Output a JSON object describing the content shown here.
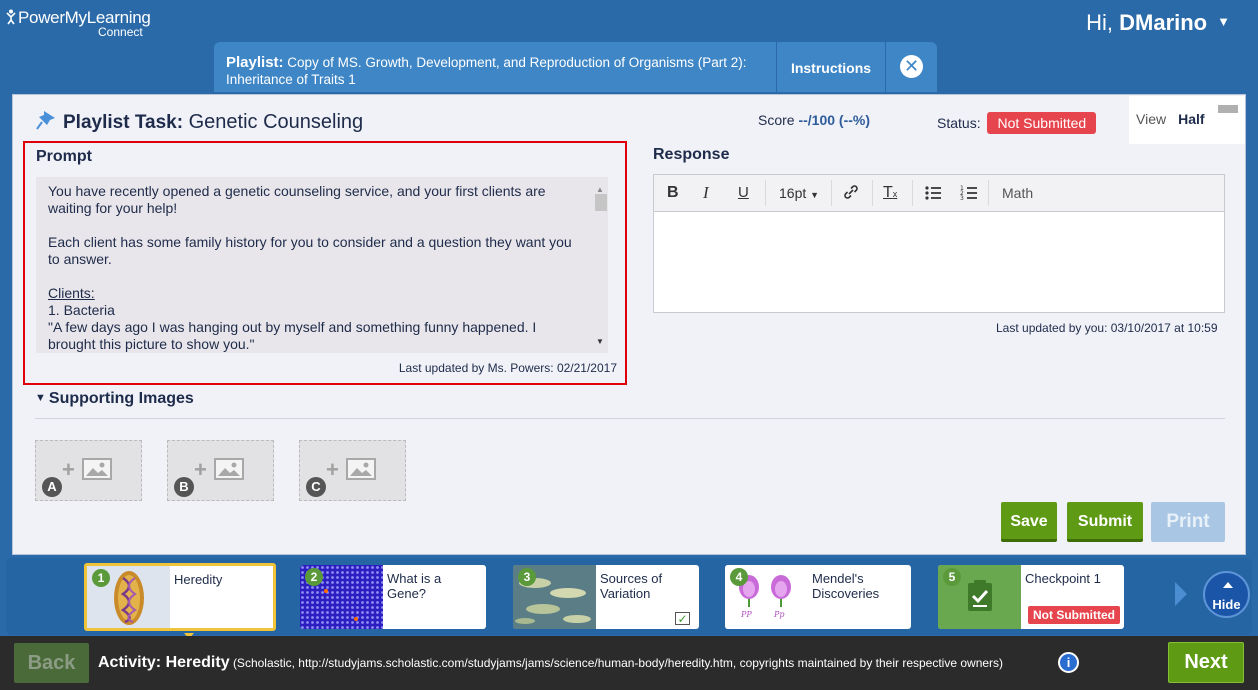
{
  "app": {
    "logo_main": "PowerMyLearning",
    "logo_sub": "Connect",
    "greeting": "Hi,",
    "username": "DMarino"
  },
  "header": {
    "playlist_label": "Playlist:",
    "playlist_title": "Copy of MS. Growth, Development, and Reproduction of Organisms (Part 2): Inheritance of Traits 1",
    "instructions_label": "Instructions"
  },
  "task": {
    "label": "Playlist Task:",
    "name": "Genetic Counseling",
    "score_label": "Score",
    "score_value": "--/100 (--%)",
    "status_label": "Status:",
    "status_value": "Not Submitted",
    "view_label": "View",
    "view_value": "Half"
  },
  "prompt": {
    "label": "Prompt",
    "para1": "You have recently opened a genetic counseling service, and your first clients are waiting for your help!",
    "para2": "Each client has some family history for you to consider and a question they want you to answer.",
    "clients_label": "Clients:",
    "client1": "1. Bacteria",
    "quote": "\"A few days ago I was hanging out by myself and something funny happened.  I brought this picture to show you.\"",
    "updated": "Last updated by Ms. Powers: 02/21/2017"
  },
  "response": {
    "label": "Response",
    "font_size": "16pt",
    "math_label": "Math",
    "updated": "Last updated by you: 03/10/2017 at 10:59"
  },
  "supporting": {
    "label": "Supporting Images",
    "slots": [
      "A",
      "B",
      "C"
    ]
  },
  "actions": {
    "save": "Save",
    "submit": "Submit",
    "print": "Print"
  },
  "activities": [
    {
      "num": "1",
      "title": "Heredity"
    },
    {
      "num": "2",
      "title": "What is a Gene?"
    },
    {
      "num": "3",
      "title": "Sources of Variation"
    },
    {
      "num": "4",
      "title": "Mendel's Discoveries"
    },
    {
      "num": "5",
      "title": "Checkpoint 1",
      "badge": "Not Submitted"
    }
  ],
  "hide_label": "Hide",
  "bottom": {
    "back": "Back",
    "activity_label": "Activity: Heredity",
    "activity_source": "(Scholastic, http://studyjams.scholastic.com/studyjams/jams/science/human-body/heredity.htm, copyrights maintained by their respective owners)",
    "next": "Next"
  },
  "colors": {
    "header_bg": "#2b6aa8",
    "status_red": "#e6454d",
    "action_green": "#5e9a14",
    "highlight_red": "#e0000b"
  }
}
